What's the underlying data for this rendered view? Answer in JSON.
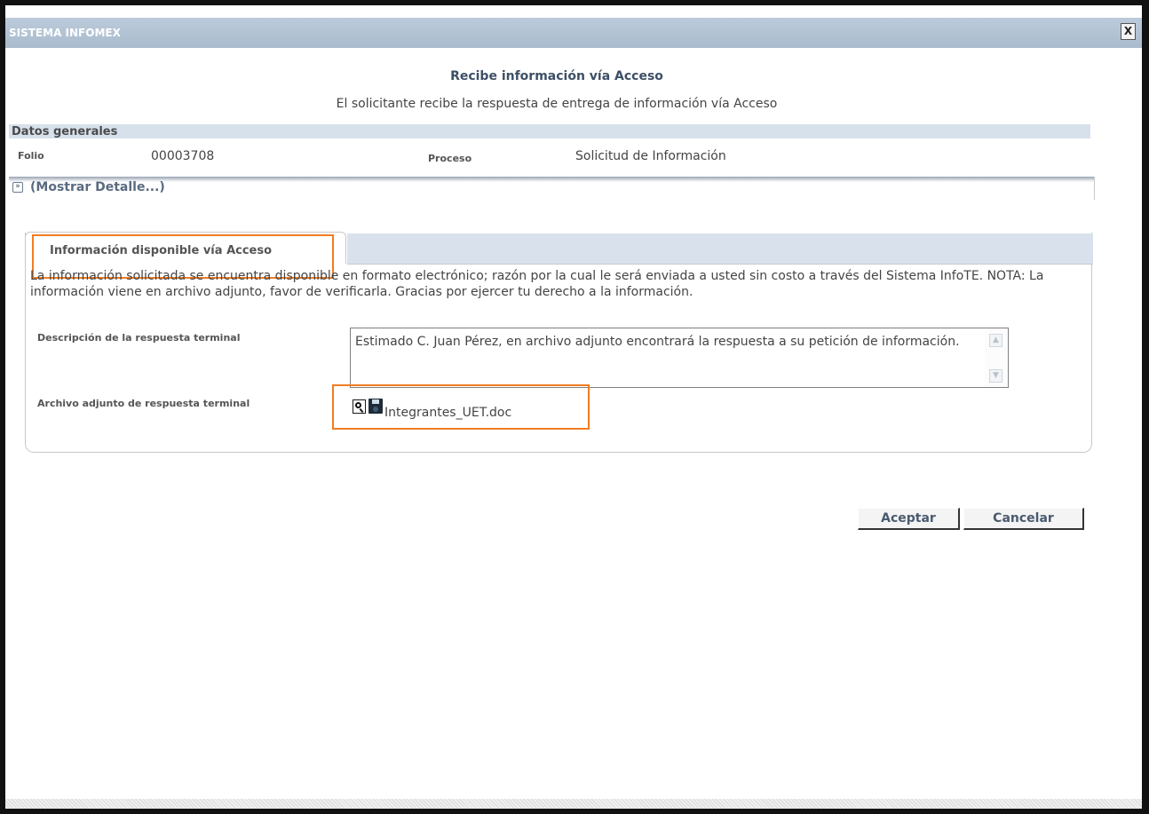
{
  "window": {
    "title": "SISTEMA INFOMEX",
    "close_label": "X"
  },
  "header": {
    "title": "Recibe información vía Acceso",
    "subtitle": "El solicitante recibe la respuesta de entrega de información vía Acceso"
  },
  "general": {
    "section_label": "Datos generales",
    "folio_label": "Folio",
    "folio_value": "00003708",
    "proceso_label": "Proceso",
    "proceso_value": "Solicitud de Información"
  },
  "detail_toggle": {
    "label": "(Mostrar Detalle...)",
    "icon": "double-chevron-down-icon"
  },
  "tab": {
    "label": "Información disponible vía Acceso"
  },
  "content": {
    "notice": "La información solicitada se encuentra disponible en formato electrónico; razón por la cual le será enviada a usted sin costo a través del Sistema InfoTE. NOTA: La información viene en archivo adjunto, favor de verificarla. Gracias por ejercer tu derecho a la información.",
    "description_label": "Descripción de la respuesta terminal",
    "description_value": "Estimado C. Juan Pérez, en archivo adjunto encontrará la respuesta a su petición de información.",
    "attachment_label": "Archivo adjunto de respuesta terminal",
    "attachment_name": "Integrantes_UET.doc",
    "attachment_icons": [
      "magnifier-view-icon",
      "floppy-save-icon"
    ]
  },
  "actions": {
    "accept_label": "Aceptar",
    "cancel_label": "Cancelar"
  },
  "colors": {
    "titlebar": "#b0c0d2",
    "highlight": "#f07d22",
    "section_bar": "#d7e1ec"
  }
}
